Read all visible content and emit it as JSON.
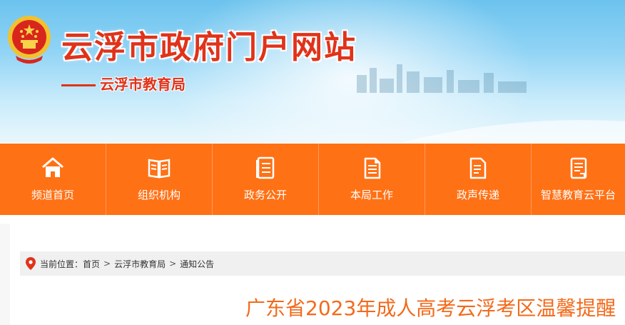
{
  "header": {
    "site_title": "云浮市政府门户网站",
    "department": "云浮市教育局"
  },
  "nav": {
    "items": [
      {
        "label": "频道首页",
        "icon": "home-icon"
      },
      {
        "label": "组织机构",
        "icon": "open-book-icon"
      },
      {
        "label": "政务公开",
        "icon": "document-list-icon"
      },
      {
        "label": "本局工作",
        "icon": "notepad-icon"
      },
      {
        "label": "政声传递",
        "icon": "document-refresh-icon"
      },
      {
        "label": "智慧教育云平台",
        "icon": "clipboard-icon"
      }
    ]
  },
  "breadcrumb": {
    "prefix": "当前位置：",
    "items": [
      "首页",
      "云浮市教育局",
      "通知公告"
    ],
    "separator": ">"
  },
  "article": {
    "title": "广东省2023年成人高考云浮考区温馨提醒"
  },
  "colors": {
    "nav_bg": "#ff7115",
    "title_red": "#e0331a",
    "article_title": "#f26a1b"
  }
}
